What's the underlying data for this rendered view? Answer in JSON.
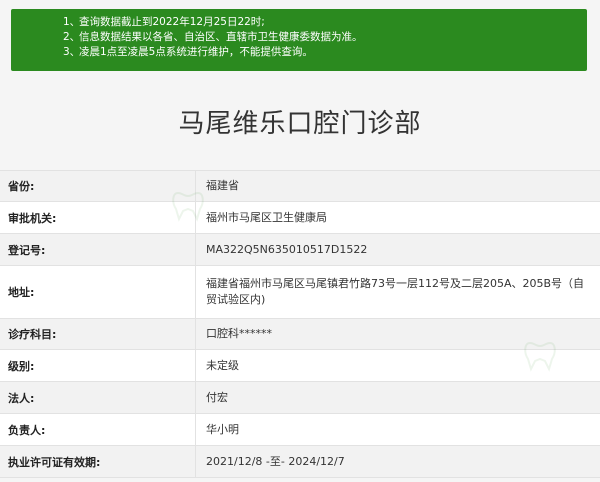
{
  "notice": {
    "items": [
      {
        "num": "1、",
        "text": "查询数据截止到2022年12月25日22时;"
      },
      {
        "num": "2、",
        "text": "信息数据结果以各省、自治区、直辖市卫生健康委数据为准。"
      },
      {
        "num": "3、",
        "text": "凌晨1点至凌晨5点系统进行维护，不能提供查询。"
      }
    ]
  },
  "title": "马尾维乐口腔门诊部",
  "rows": [
    {
      "label": "省份:",
      "value": "福建省"
    },
    {
      "label": "审批机关:",
      "value": "福州市马尾区卫生健康局"
    },
    {
      "label": "登记号:",
      "value": "MA322Q5N635010517D1522"
    },
    {
      "label": "地址:",
      "value": "福建省福州市马尾区马尾镇君竹路73号一层112号及二层205A、205B号（自贸试验区内)"
    },
    {
      "label": "诊疗科目:",
      "value": "口腔科******"
    },
    {
      "label": "级别:",
      "value": "未定级"
    },
    {
      "label": "法人:",
      "value": "付宏"
    },
    {
      "label": "负责人:",
      "value": "华小明"
    },
    {
      "label": "执业许可证有效期:",
      "value": "2021/12/8 -至- 2024/12/7"
    }
  ],
  "colors": {
    "notice_bg": "#2b8a1f",
    "row_alt": "#f2f2f2"
  }
}
